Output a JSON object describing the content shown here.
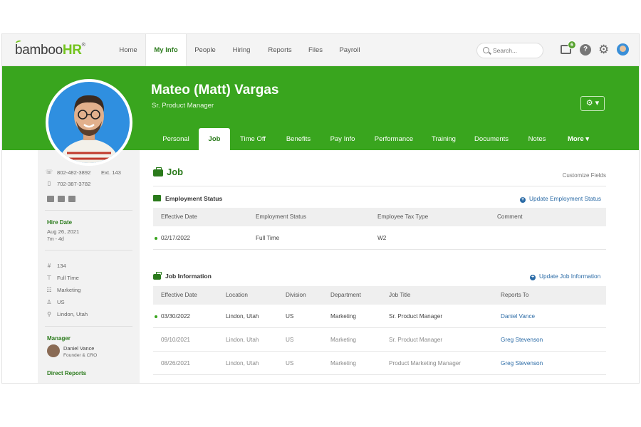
{
  "app": {
    "logo_text": "bamboo",
    "logo_accent": "HR",
    "logo_mark": "®"
  },
  "nav": {
    "items": [
      {
        "label": "Home"
      },
      {
        "label": "My Info"
      },
      {
        "label": "People"
      },
      {
        "label": "Hiring"
      },
      {
        "label": "Reports"
      },
      {
        "label": "Files"
      },
      {
        "label": "Payroll"
      }
    ],
    "active": "My Info",
    "search_placeholder": "Search...",
    "inbox_badge": "6",
    "help_glyph": "?"
  },
  "profile": {
    "name": "Mateo (Matt) Vargas",
    "title": "Sr. Product Manager",
    "settings_label": "⚙ ▾"
  },
  "tabs": [
    {
      "label": "Personal"
    },
    {
      "label": "Job"
    },
    {
      "label": "Time Off"
    },
    {
      "label": "Benefits"
    },
    {
      "label": "Pay Info"
    },
    {
      "label": "Performance"
    },
    {
      "label": "Training"
    },
    {
      "label": "Documents"
    },
    {
      "label": "Notes"
    },
    {
      "label": "More ▾"
    }
  ],
  "active_tab": "Job",
  "sidebar": {
    "work_phone": "802-482-3892",
    "ext": "Ext. 143",
    "mobile": "702-387-3782",
    "hire_date_label": "Hire Date",
    "hire_date": "Aug 26, 2021",
    "tenure": "7m - 4d",
    "employee_number": "134",
    "employment_type": "Full Time",
    "department": "Marketing",
    "country": "US",
    "location": "Lindon, Utah",
    "manager_label": "Manager",
    "manager_name": "Daniel Vance",
    "manager_title": "Founder & CRO",
    "direct_reports_label": "Direct Reports"
  },
  "main": {
    "page_title": "Job",
    "customize_link": "Customize Fields",
    "employment_status": {
      "title": "Employment Status",
      "update_link": "Update Employment Status",
      "columns": [
        "Effective Date",
        "Employment Status",
        "Employee Tax Type",
        "Comment"
      ],
      "rows": [
        {
          "date": "02/17/2022",
          "status": "Full Time",
          "tax": "W2",
          "comment": ""
        }
      ]
    },
    "job_information": {
      "title": "Job Information",
      "update_link": "Update Job Information",
      "columns": [
        "Effective Date",
        "Location",
        "Division",
        "Department",
        "Job Title",
        "Reports To"
      ],
      "rows": [
        {
          "date": "03/30/2022",
          "location": "Lindon, Utah",
          "division": "US",
          "department": "Marketing",
          "job_title": "Sr. Product Manager",
          "reports_to": "Daniel Vance"
        },
        {
          "date": "09/10/2021",
          "location": "Lindon, Utah",
          "division": "US",
          "department": "Marketing",
          "job_title": "Sr. Product Manager",
          "reports_to": "Greg Stevenson"
        },
        {
          "date": "08/26/2021",
          "location": "Lindon, Utah",
          "division": "US",
          "department": "Marketing",
          "job_title": "Product Marketing Manager",
          "reports_to": "Greg Stevenson"
        }
      ]
    }
  },
  "colors": {
    "brand_green": "#39a51e",
    "text_green": "#2a7a1b",
    "link_blue": "#2b6ba6"
  }
}
